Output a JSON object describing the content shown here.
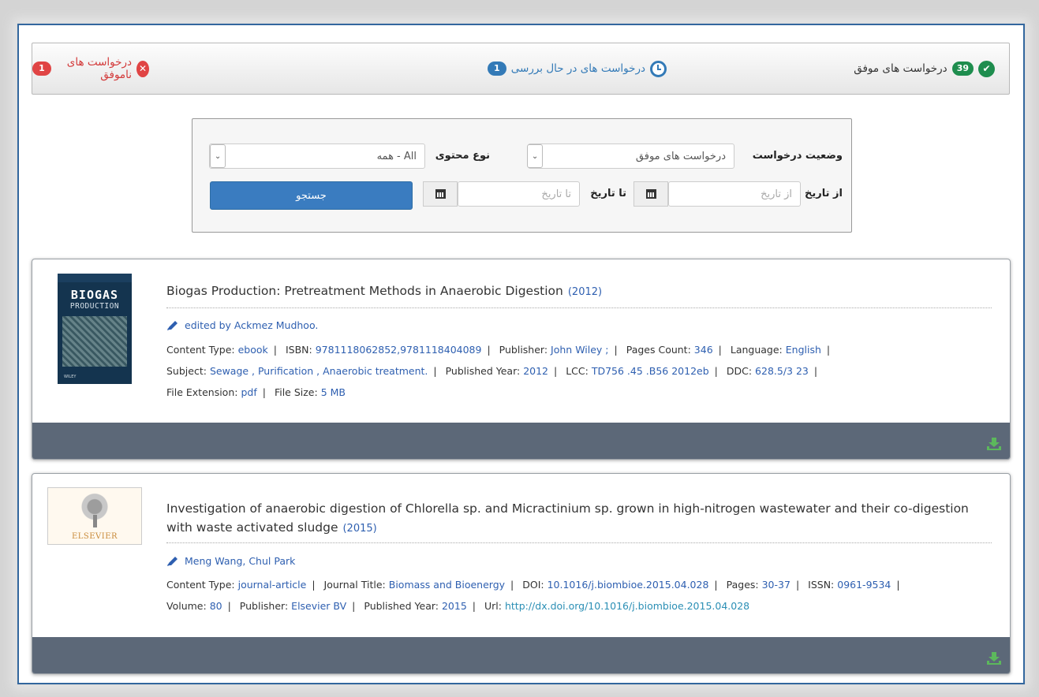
{
  "tabs": {
    "success": {
      "label": "درخواست های موفق",
      "count": "39"
    },
    "pending": {
      "label": "درخواست های در حال بررسی",
      "count": "1"
    },
    "failed": {
      "label": "درخواست های ناموفق",
      "count": "1"
    }
  },
  "filter": {
    "status_label": "وضعیت درخواست",
    "status_value": "درخواست های موفق",
    "content_type_label": "نوع محتوی",
    "content_type_value": "All - همه",
    "from_date_label": "از تاریخ",
    "from_date_placeholder": "از تاریخ",
    "to_date_label": "تا تاریخ",
    "to_date_placeholder": "تا تاریخ",
    "search_button": "جستجو"
  },
  "results": [
    {
      "title": "Biogas Production: Pretreatment Methods in Anaerobic Digestion",
      "year": "(2012)",
      "authors": "edited by Ackmez Mudhoo.",
      "cover_text": "BIOGAS",
      "cover_sub": "PRODUCTION",
      "cover_publisher": "WILEY",
      "meta": {
        "content_type_label": "Content Type:",
        "content_type": "ebook",
        "isbn_label": "ISBN:",
        "isbn": "9781118062852,9781118404089",
        "publisher_label": "Publisher:",
        "publisher": "John Wiley ;",
        "pages_count_label": "Pages Count:",
        "pages_count": "346",
        "language_label": "Language:",
        "language": "English",
        "subject_label": "Subject:",
        "subject": "Sewage , Purification , Anaerobic treatment.",
        "published_year_label": "Published Year:",
        "published_year": "2012",
        "lcc_label": "LCC:",
        "lcc": "TD756 .45 .B56 2012eb",
        "ddc_label": "DDC:",
        "ddc": "628.5/3 23",
        "file_ext_label": "File Extension:",
        "file_ext": "pdf",
        "file_size_label": "File Size:",
        "file_size": "5 MB"
      }
    },
    {
      "title": "Investigation of anaerobic digestion of Chlorella sp. and Micractinium sp. grown in high-nitrogen wastewater and their co-digestion with waste activated sludge",
      "year": "(2015)",
      "authors": "Meng Wang, Chul Park",
      "logo_text": "ELSEVIER",
      "meta": {
        "content_type_label": "Content Type:",
        "content_type": "journal-article",
        "journal_title_label": "Journal Title:",
        "journal_title": "Biomass and Bioenergy",
        "doi_label": "DOI:",
        "doi": "10.1016/j.biombioe.2015.04.028",
        "pages_label": "Pages:",
        "pages": "30-37",
        "issn_label": "ISSN:",
        "issn": "0961-9534",
        "volume_label": "Volume:",
        "volume": "80",
        "publisher_label": "Publisher:",
        "publisher": "Elsevier BV",
        "published_year_label": "Published Year:",
        "published_year": "2015",
        "url_label": "Url:",
        "url": "http://dx.doi.org/10.1016/j.biombioe.2015.04.028"
      }
    }
  ],
  "separator": "|",
  "colors": {
    "accent": "#337ab7",
    "success": "#1e8d4e",
    "danger": "#e04444",
    "footer": "#5c6878",
    "download": "#5cb85c"
  }
}
